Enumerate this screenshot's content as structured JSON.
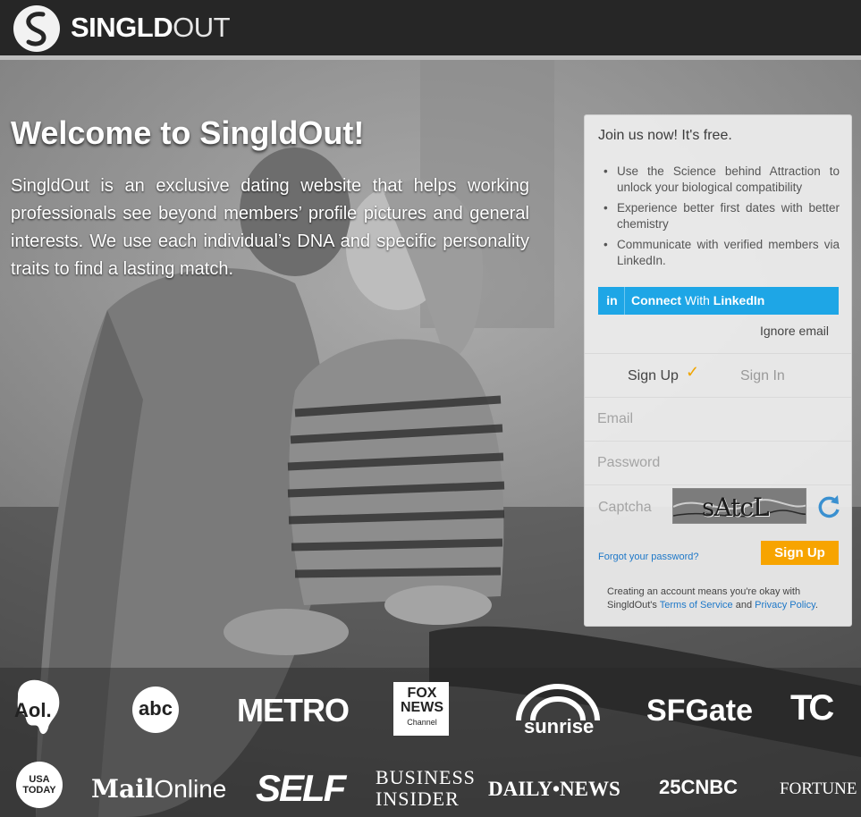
{
  "header": {
    "brand_bold": "SINGLD",
    "brand_light": "OUT"
  },
  "hero": {
    "title": "Welcome to SingldOut!",
    "description": "SingldOut is an exclusive dating website that helps working professionals see beyond members’ profile pictures and general interests. We use each individual’s DNA and specific personality traits to find a lasting match."
  },
  "panel": {
    "title": "Join us now! It's free.",
    "bullets": [
      "Use the Science behind Attraction to unlock your biological compatibility",
      "Experience better first dates with better chemistry",
      "Communicate with verified members via LinkedIn."
    ],
    "linkedin_badge": "in",
    "linkedin_lead": "Connect",
    "linkedin_mid": " With ",
    "linkedin_brand": "LinkedIn",
    "ignore_email": "Ignore email",
    "tab_signup": "Sign Up",
    "tab_signin": "Sign In",
    "email_placeholder": "Email",
    "password_placeholder": "Password",
    "captcha_label": "Captcha",
    "captcha_text": "sAtcL",
    "forgot": "Forgot your password?",
    "signup_button": "Sign Up",
    "terms_prefix": "Creating an account means you're okay with SingldOut's ",
    "terms_link": "Terms of Service",
    "terms_and": " and ",
    "privacy_link": "Privacy Policy",
    "terms_suffix": "."
  },
  "press": {
    "aol": "Aol.",
    "abc": "abc",
    "metro": "METRO",
    "fox_1": "FOX",
    "fox_2": "NEWS",
    "fox_3": "Channel",
    "sunrise": "sunrise",
    "sfgate": "SFGate",
    "techcrunch": "TC",
    "usa_1": "USA",
    "usa_2": "TODAY",
    "mail_bold": "Mail",
    "mail_light": "Online",
    "self": "SELF",
    "bi_1": "BUSINESS",
    "bi_2": "INSIDER",
    "daily": "DAILY•NEWS",
    "cnbc": "25CNBC",
    "fortune": "FORTUNE"
  },
  "colors": {
    "linkedin": "#1ea6e6",
    "signup": "#f7a400",
    "link": "#1e78c8",
    "check": "#f0a500"
  }
}
